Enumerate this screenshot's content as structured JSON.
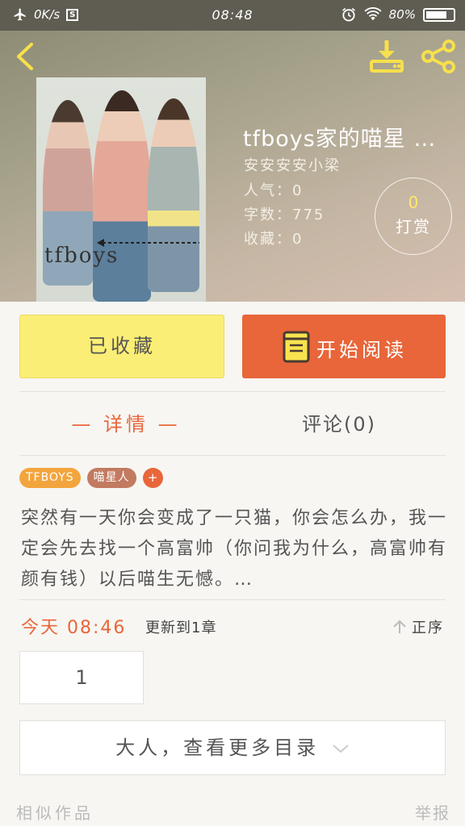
{
  "status_bar": {
    "speed": "0K/s",
    "s_badge": "S",
    "time": "08:48",
    "battery": "80%",
    "battery_level": 0.8
  },
  "header": {
    "cover_text": "tfboys",
    "title": "tfboys家的喵星 …",
    "author": "安安安安小梁",
    "popularity": "人气：0",
    "word_count": "字数：775",
    "collections": "收藏：0",
    "tip_count": "0",
    "tip_label": "打赏"
  },
  "actions": {
    "collected": "已收藏",
    "start_reading": "开始阅读"
  },
  "tabs": {
    "detail": "— 详情 —",
    "comments": "评论(0)"
  },
  "tags": [
    {
      "label": "TFBOYS",
      "color": "#f3a53d"
    },
    {
      "label": "喵星人",
      "color": "#c27a60"
    }
  ],
  "tag_add": "+",
  "summary": "突然有一天你会变成了一只猫，你会怎么办，我一定会先去找一个高富帅（你问我为什么，高富帅有颜有钱）以后喵生无憾。…",
  "update": {
    "date": "今天 08:46",
    "text": "更新到1章",
    "order": "正序"
  },
  "chapter": "1",
  "more_catalog": "大人，查看更多目录",
  "footer": {
    "similar": "相似作品",
    "report": "举报"
  },
  "colors": {
    "accent": "#e8663a",
    "collect_yellow": "#fbee76"
  }
}
